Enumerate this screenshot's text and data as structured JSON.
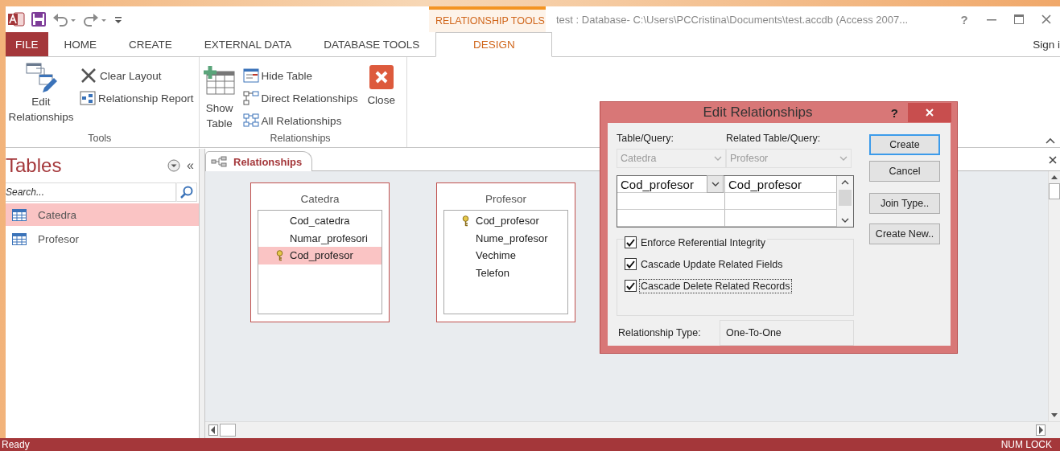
{
  "title_bar": {
    "contextual_tab": "RELATIONSHIP TOOLS",
    "title": "test : Database- C:\\Users\\PCCristina\\Documents\\test.accdb (Access 2007...",
    "help": "?"
  },
  "ribbon_tabs": [
    {
      "label": "FILE",
      "kind": "file",
      "selected": false
    },
    {
      "label": "HOME",
      "kind": "normal",
      "selected": false
    },
    {
      "label": "CREATE",
      "kind": "normal",
      "selected": false
    },
    {
      "label": "EXTERNAL DATA",
      "kind": "normal",
      "selected": false
    },
    {
      "label": "DATABASE TOOLS",
      "kind": "normal",
      "selected": false
    },
    {
      "label": "DESIGN",
      "kind": "contextual",
      "selected": true
    }
  ],
  "sign_in": "Sign i",
  "ribbon_groups": [
    {
      "label": "Tools",
      "items": [
        {
          "label": "Edit Relationships",
          "kind": "large"
        },
        {
          "label": "Clear Layout",
          "kind": "small"
        },
        {
          "label": "Relationship Report",
          "kind": "small"
        }
      ]
    },
    {
      "label": "Relationships",
      "items": [
        {
          "label": "Show Table",
          "kind": "large"
        },
        {
          "label": "Hide Table",
          "kind": "small"
        },
        {
          "label": "Direct Relationships",
          "kind": "small"
        },
        {
          "label": "All Relationships",
          "kind": "small"
        },
        {
          "label": "Close",
          "kind": "large"
        }
      ]
    }
  ],
  "nav": {
    "title": "Tables",
    "collapse": "«",
    "search_placeholder": "Search...",
    "items": [
      {
        "label": "Catedra",
        "selected": true
      },
      {
        "label": "Profesor",
        "selected": false
      }
    ]
  },
  "document_tab": {
    "label": "Relationships",
    "selected": true
  },
  "tables": [
    {
      "name": "Catedra",
      "fields": [
        {
          "name": "Cod_catedra",
          "key": false,
          "selected": false
        },
        {
          "name": "Numar_profesori",
          "key": false,
          "selected": false
        },
        {
          "name": "Cod_profesor",
          "key": true,
          "selected": true
        }
      ]
    },
    {
      "name": "Profesor",
      "fields": [
        {
          "name": "Cod_profesor",
          "key": true,
          "selected": false
        },
        {
          "name": "Nume_profesor",
          "key": false,
          "selected": false
        },
        {
          "name": "Vechime",
          "key": false,
          "selected": false
        },
        {
          "name": "Telefon",
          "key": false,
          "selected": false
        }
      ]
    }
  ],
  "dialog": {
    "title": "Edit Relationships",
    "help": "?",
    "table_label": "Table/Query:",
    "table_combo": {
      "value": "Catedra",
      "disabled": true
    },
    "related_label": "Related Table/Query:",
    "related_combo": {
      "value": "Profesor",
      "disabled": true
    },
    "join_rows": [
      {
        "table_field": "Cod_profesor",
        "related_field": "Cod_profesor"
      }
    ],
    "options": [
      {
        "label": "Enforce Referential Integrity",
        "checked": true,
        "focused": false
      },
      {
        "label": "Cascade Update Related Fields",
        "checked": true,
        "focused": false
      },
      {
        "label": "Cascade Delete Related Records",
        "checked": true,
        "focused": true
      }
    ],
    "type_label": "Relationship Type:",
    "type_value": "One-To-One",
    "buttons": [
      {
        "label": "Create",
        "default": true
      },
      {
        "label": "Cancel",
        "default": false
      },
      {
        "label": "Join Type..",
        "default": false
      },
      {
        "label": "Create New..",
        "default": false
      }
    ]
  },
  "status_bar": {
    "left": "Ready",
    "right": "NUM LOCK"
  }
}
